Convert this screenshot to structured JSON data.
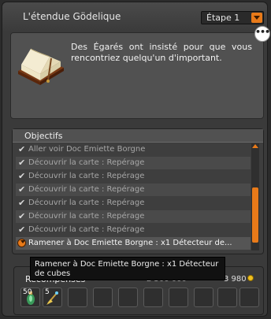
{
  "window": {
    "title": "L'étendue Gödelique"
  },
  "step_select": {
    "value": "Étape 1"
  },
  "description": {
    "text": "Des Égarés ont insisté pour que vous rencontriez quelqu'un d'important.",
    "more_label": "•••"
  },
  "objectives": {
    "title": "Objectifs",
    "items": [
      {
        "label": "Aller voir Doc Emiette Borgne",
        "done": true
      },
      {
        "label": "Découvrir la carte : Repérage",
        "done": true
      },
      {
        "label": "Découvrir la carte : Repérage",
        "done": true
      },
      {
        "label": "Découvrir la carte : Repérage",
        "done": true
      },
      {
        "label": "Découvrir la carte : Repérage",
        "done": true
      },
      {
        "label": "Découvrir la carte : Repérage",
        "done": true
      },
      {
        "label": "Découvrir la carte : Repérage",
        "done": true
      },
      {
        "label": "Ramener à Doc Emiette Borgne : x1 Détecteur de...",
        "done": false
      }
    ]
  },
  "tooltip": {
    "text": "Ramener à Doc Emiette Borgne : x1 Détecteur de cubes"
  },
  "rewards": {
    "label": "Récompenses",
    "xp": "2 500 000",
    "kamas": "3 980",
    "slots": [
      {
        "qty": "50",
        "icon": "potion-icon"
      },
      {
        "qty": "5",
        "icon": "broom-icon"
      },
      {
        "qty": ""
      },
      {
        "qty": ""
      },
      {
        "qty": ""
      },
      {
        "qty": ""
      },
      {
        "qty": ""
      },
      {
        "qty": ""
      },
      {
        "qty": ""
      },
      {
        "qty": ""
      }
    ]
  },
  "colors": {
    "accent": "#e87a19",
    "panel": "#3a3a3a",
    "text": "#e6e6e6"
  }
}
